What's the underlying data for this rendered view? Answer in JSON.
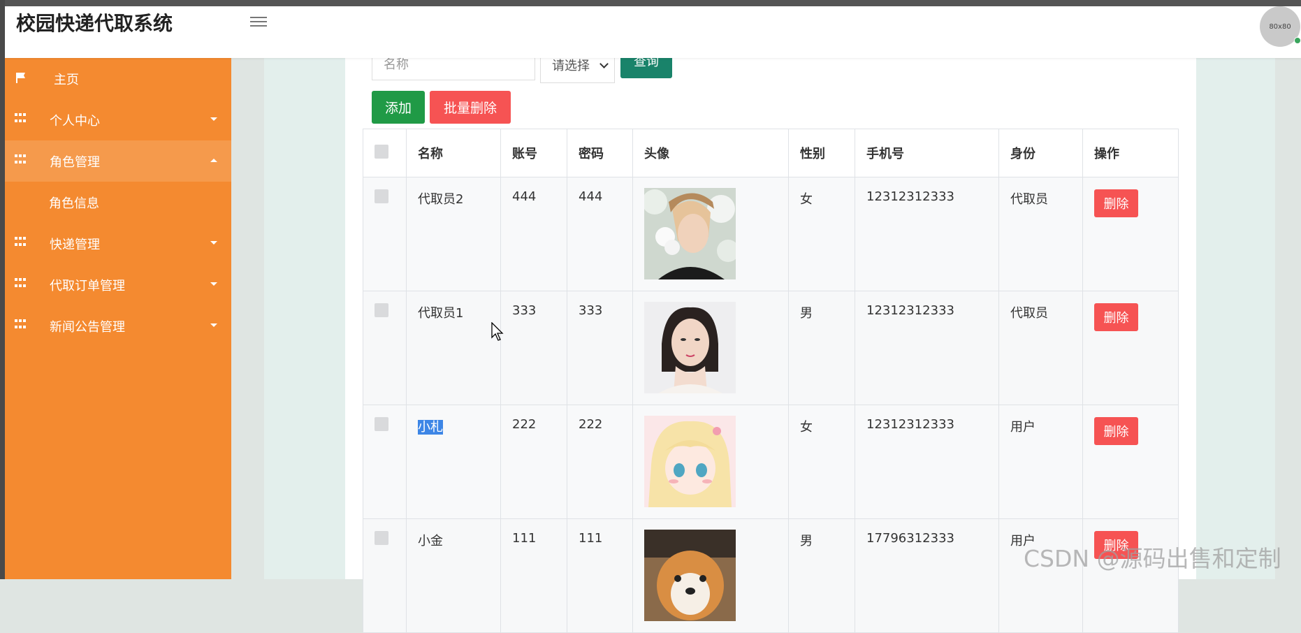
{
  "app": {
    "title": "校园快递代取系统",
    "avatar_text": "80x80"
  },
  "sidebar": {
    "items": [
      {
        "label": "主页",
        "icon": "flag-icon"
      },
      {
        "label": "个人中心",
        "icon": "grid-icon"
      },
      {
        "label": "角色管理",
        "icon": "grid-icon",
        "expanded": true
      },
      {
        "label": "角色信息"
      },
      {
        "label": "快递管理",
        "icon": "grid-icon"
      },
      {
        "label": "代取订单管理",
        "icon": "grid-icon"
      },
      {
        "label": "新闻公告管理",
        "icon": "grid-icon"
      }
    ]
  },
  "search": {
    "name_placeholder": "名称",
    "select_value": "请选择",
    "query_label": "查询"
  },
  "actions": {
    "add_label": "添加",
    "batch_delete_label": "批量删除"
  },
  "table": {
    "headers": [
      "名称",
      "账号",
      "密码",
      "头像",
      "性别",
      "手机号",
      "身份",
      "操作"
    ],
    "delete_label": "删除",
    "rows": [
      {
        "name": "代取员2",
        "account": "444",
        "password": "444",
        "gender": "女",
        "phone": "12312312333",
        "role": "代取员",
        "avatar": "photo-young-man-flowers"
      },
      {
        "name": "代取员1",
        "account": "333",
        "password": "333",
        "gender": "男",
        "phone": "12312312333",
        "role": "代取员",
        "avatar": "photo-woman-portrait"
      },
      {
        "name": "小札",
        "account": "222",
        "password": "222",
        "gender": "女",
        "phone": "12312312333",
        "role": "用户",
        "avatar": "anime-girl"
      },
      {
        "name": "小金",
        "account": "111",
        "password": "111",
        "gender": "男",
        "phone": "17796312333",
        "role": "用户",
        "avatar": "shiba-dog"
      }
    ]
  },
  "watermark": "CSDN @源码出售和定制",
  "colors": {
    "sidebar": "#f48a30",
    "primary_green": "#209a46",
    "danger_red": "#f65353",
    "query_teal": "#19836a"
  }
}
